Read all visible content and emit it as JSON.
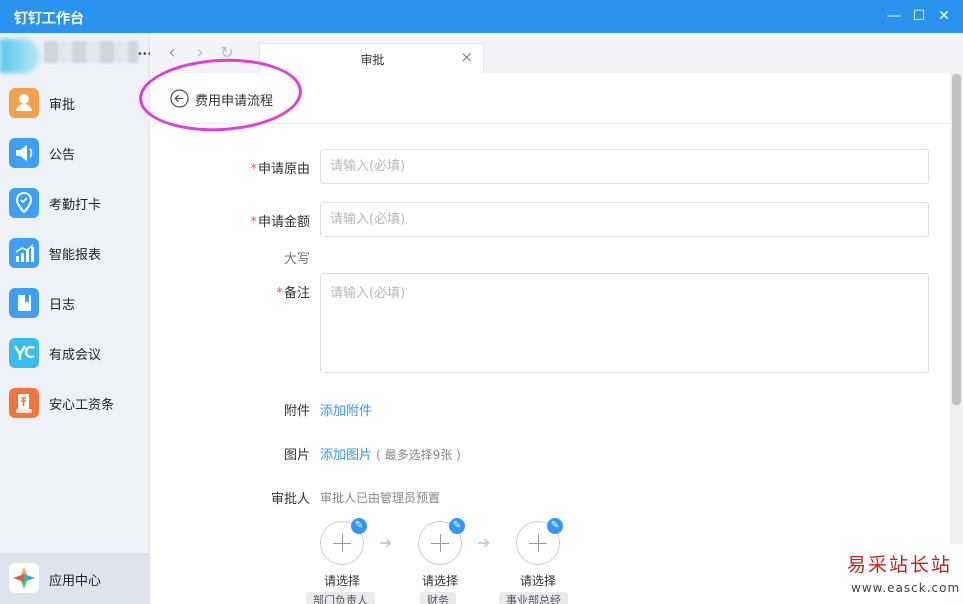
{
  "window": {
    "title": "钉钉工作台",
    "controls": {
      "minimize": "—",
      "maximize": "☐",
      "close": "✕"
    }
  },
  "sidebar": {
    "items": [
      {
        "label": "审批",
        "icon": "approval-icon",
        "color": "#f5a04a"
      },
      {
        "label": "公告",
        "icon": "megaphone-icon",
        "color": "#3d9ff5"
      },
      {
        "label": "考勤打卡",
        "icon": "location-pin-icon",
        "color": "#3d9ff5"
      },
      {
        "label": "智能报表",
        "icon": "bar-chart-icon",
        "color": "#3d9ff5"
      },
      {
        "label": "日志",
        "icon": "notebook-icon",
        "color": "#3d9ff5"
      },
      {
        "label": "有成会议",
        "icon": "meeting-icon",
        "color": "#38bdf0"
      },
      {
        "label": "安心工资条",
        "icon": "salary-slip-icon",
        "color": "#f0753a"
      }
    ],
    "app_center": {
      "label": "应用中心",
      "icon": "app-center-icon"
    }
  },
  "toolbar": {
    "back": "‹",
    "forward": "›",
    "refresh": "↻"
  },
  "tab": {
    "label": "审批",
    "close": "×"
  },
  "page": {
    "title": "费用申请流程"
  },
  "form": {
    "reason": {
      "label": "申请原由",
      "placeholder": "请输入(必填)"
    },
    "amount": {
      "label": "申请金额",
      "placeholder": "请输入(必填)"
    },
    "uppercase": {
      "label": "大写"
    },
    "remark": {
      "label": "备注",
      "placeholder": "请输入(必填)"
    },
    "attachment": {
      "label": "附件",
      "action": "添加附件"
    },
    "image": {
      "label": "图片",
      "action": "添加图片",
      "hint": "( 最多选择9张 )"
    },
    "approver": {
      "label": "审批人",
      "note": "审批人已由管理员预置",
      "nodes": [
        {
          "label": "请选择",
          "role": "部门负责人"
        },
        {
          "label": "请选择",
          "role": "财务"
        },
        {
          "label": "请选择",
          "role": "事业部总经"
        }
      ]
    }
  },
  "watermark": {
    "text": "易采站长站",
    "url": "www.easck.com"
  },
  "colors": {
    "titlebar": "#2a93f0",
    "accent": "#3296fa",
    "required": "#f25643",
    "highlight_ellipse": "#e23cdb"
  }
}
